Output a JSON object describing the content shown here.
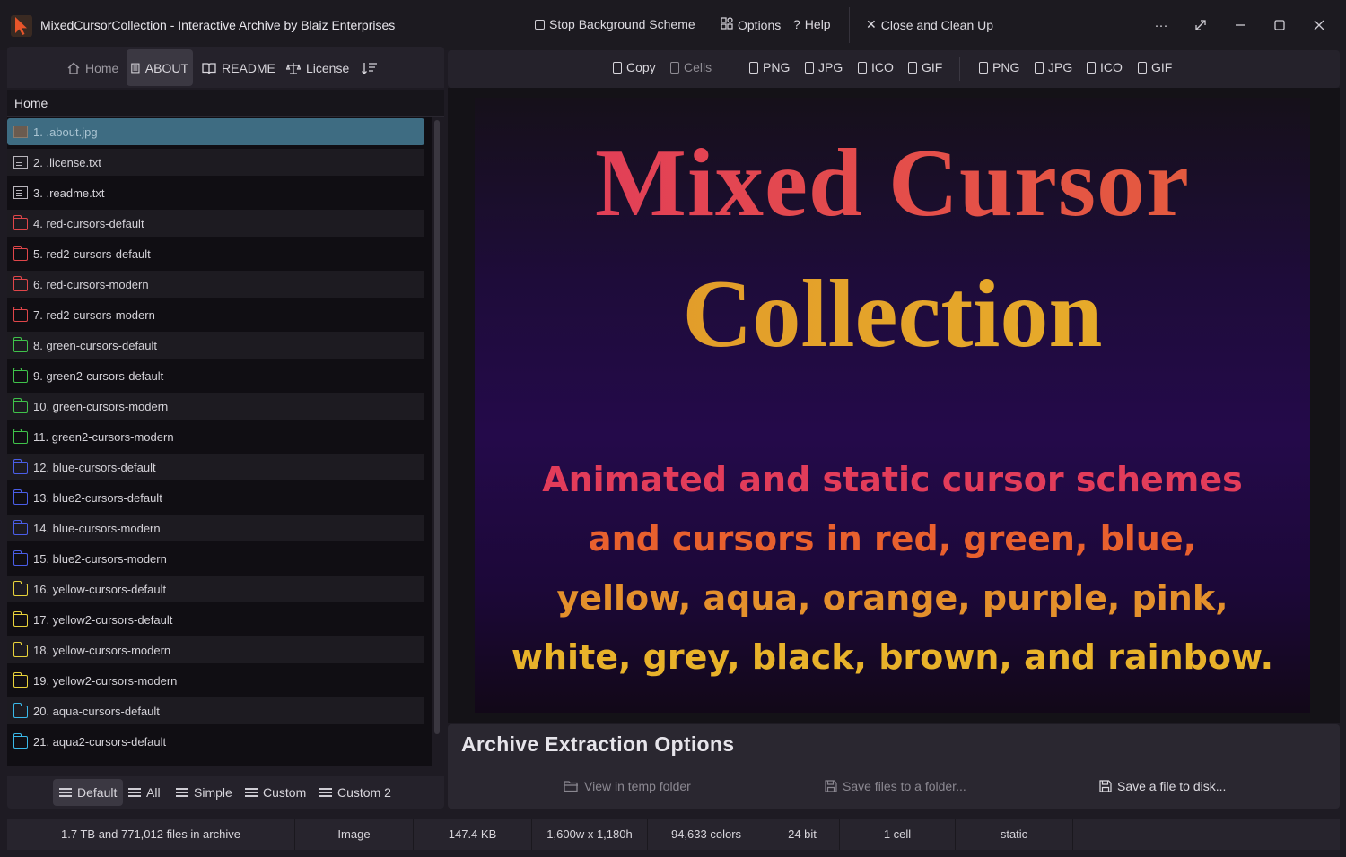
{
  "app": {
    "title": "MixedCursorCollection  -  Interactive Archive by Blaiz Enterprises",
    "stop_scheme": "Stop Background Scheme",
    "options": "Options",
    "help": "Help",
    "close_clean": "Close and Clean Up",
    "more": "···"
  },
  "left_tabs": {
    "home": "Home",
    "about": "ABOUT",
    "readme": "README",
    "license": "License"
  },
  "breadcrumb": "Home",
  "files": [
    {
      "label": "1.  .about.jpg",
      "kind": "image",
      "color": "#9b9"
    },
    {
      "label": "2.  .license.txt",
      "kind": "doc",
      "color": "#b8b5bc"
    },
    {
      "label": "3.  .readme.txt",
      "kind": "doc",
      "color": "#b8b5bc"
    },
    {
      "label": "4.  red-cursors-default",
      "kind": "folder",
      "color": "#e0464a"
    },
    {
      "label": "5.  red2-cursors-default",
      "kind": "folder",
      "color": "#e0464a"
    },
    {
      "label": "6.  red-cursors-modern",
      "kind": "folder",
      "color": "#e0464a"
    },
    {
      "label": "7.  red2-cursors-modern",
      "kind": "folder",
      "color": "#e0464a"
    },
    {
      "label": "8.  green-cursors-default",
      "kind": "folder",
      "color": "#3fc24a"
    },
    {
      "label": "9.  green2-cursors-default",
      "kind": "folder",
      "color": "#3fc24a"
    },
    {
      "label": "10.  green-cursors-modern",
      "kind": "folder",
      "color": "#3fc24a"
    },
    {
      "label": "11.  green2-cursors-modern",
      "kind": "folder",
      "color": "#3fc24a"
    },
    {
      "label": "12.  blue-cursors-default",
      "kind": "folder",
      "color": "#4a5ee8"
    },
    {
      "label": "13.  blue2-cursors-default",
      "kind": "folder",
      "color": "#4a5ee8"
    },
    {
      "label": "14.  blue-cursors-modern",
      "kind": "folder",
      "color": "#4a5ee8"
    },
    {
      "label": "15.  blue2-cursors-modern",
      "kind": "folder",
      "color": "#4a5ee8"
    },
    {
      "label": "16.  yellow-cursors-default",
      "kind": "folder",
      "color": "#e8d23a"
    },
    {
      "label": "17.  yellow2-cursors-default",
      "kind": "folder",
      "color": "#e8d23a"
    },
    {
      "label": "18.  yellow-cursors-modern",
      "kind": "folder",
      "color": "#e8d23a"
    },
    {
      "label": "19.  yellow2-cursors-modern",
      "kind": "folder",
      "color": "#e8d23a"
    },
    {
      "label": "20.  aqua-cursors-default",
      "kind": "folder",
      "color": "#3ab8e8"
    },
    {
      "label": "21.  aqua2-cursors-default",
      "kind": "folder",
      "color": "#3ab8e8"
    }
  ],
  "bottom_tabs": {
    "default": "Default",
    "all": "All",
    "simple": "Simple",
    "custom": "Custom",
    "custom2": "Custom 2"
  },
  "toolbar": {
    "copy": "Copy",
    "cells": "Cells",
    "png": "PNG",
    "jpg": "JPG",
    "ico": "ICO",
    "gif": "GIF"
  },
  "poster": {
    "title_line1": "Mixed Cursor",
    "title_line2": "Collection",
    "sub1": "Animated and static cursor schemes",
    "sub2": "and cursors in red, green, blue,",
    "sub3": "yellow, aqua, orange, purple, pink,",
    "sub4": "white, grey, black, brown, and rainbow."
  },
  "extraction": {
    "title": "Archive Extraction Options",
    "view_temp": "View in temp folder",
    "save_folder": "Save files to a folder...",
    "save_file": "Save a file to disk..."
  },
  "status": {
    "archive": "1.7 TB and 771,012 files in archive",
    "type": "Image",
    "size": "147.4 KB",
    "dims": "1,600w x 1,180h",
    "colors": "94,633 colors",
    "bits": "24 bit",
    "cells": "1 cell",
    "anim": "static"
  }
}
